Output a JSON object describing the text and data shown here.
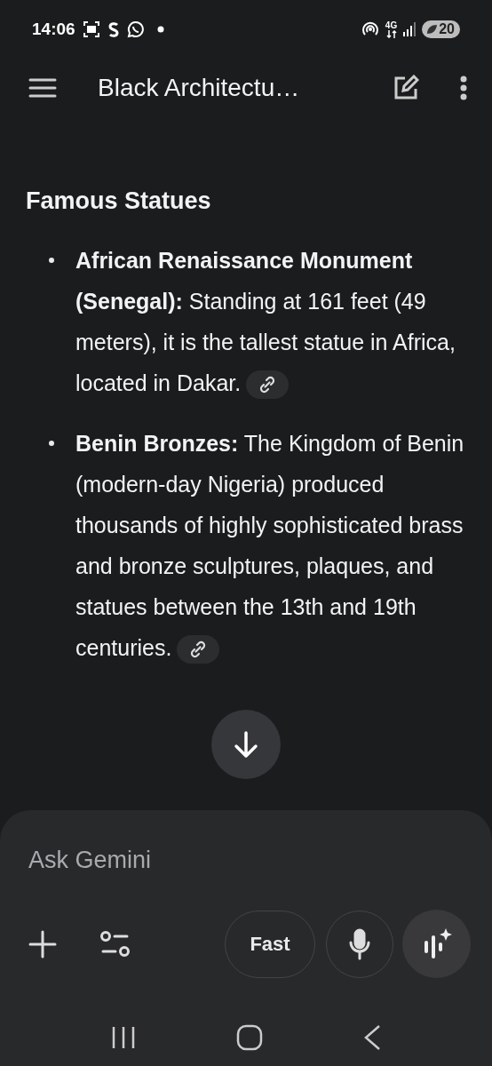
{
  "status_bar": {
    "time": "14:06",
    "network": "4G",
    "battery": "20"
  },
  "app_bar": {
    "title": "Black Architectu…"
  },
  "content": {
    "heading": "Famous Statues",
    "items": [
      {
        "text": "**African Renaissance Monument (Senegal):** Standing at 161 feet (49 meters), it is the tallest statue in Africa, located in Dakar.",
        "source_chip": true
      },
      {
        "text": "**Benin Bronzes:** The Kingdom of Benin (modern-day Nigeria) produced thousands of highly sophisticated brass and bronze sculptures, plaques, and statues between the 13th and 19th centuries.",
        "source_chip": true
      }
    ]
  },
  "composer": {
    "placeholder": "Ask Gemini",
    "mode_button": "Fast"
  }
}
